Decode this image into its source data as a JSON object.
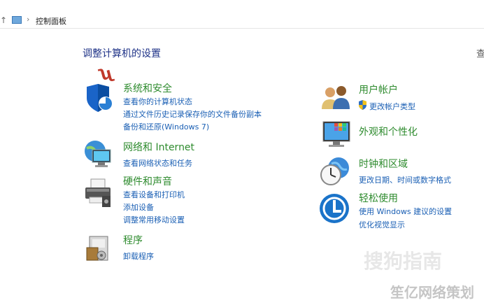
{
  "address_bar": {
    "up_glyph": "↑",
    "separator": "›",
    "breadcrumb": "控制面板"
  },
  "header": {
    "title": "调整计算机的设置",
    "view_by_cut": "查"
  },
  "annotation": {
    "red_mark": "ʯ"
  },
  "categories": {
    "system": {
      "title": "系统和安全",
      "links": [
        "查看你的计算机状态",
        "通过文件历史记录保存你的文件备份副本",
        "备份和还原(Windows 7)"
      ]
    },
    "network": {
      "title": "网络和 Internet",
      "links": [
        "查看网络状态和任务"
      ]
    },
    "hardware": {
      "title": "硬件和声音",
      "links": [
        "查看设备和打印机",
        "添加设备",
        "调整常用移动设置"
      ]
    },
    "programs": {
      "title": "程序",
      "links": [
        "卸载程序"
      ]
    },
    "users": {
      "title": "用户帐户",
      "links": [
        "更改帐户类型"
      ]
    },
    "appearance": {
      "title": "外观和个性化",
      "links": []
    },
    "clock": {
      "title": "时钟和区域",
      "links": [
        "更改日期、时间或数字格式"
      ]
    },
    "ease": {
      "title": "轻松使用",
      "links": [
        "使用 Windows 建议的设置",
        "优化视觉显示"
      ]
    }
  },
  "watermarks": {
    "site": "搜狗指南",
    "brand": "笙亿网络策划"
  }
}
